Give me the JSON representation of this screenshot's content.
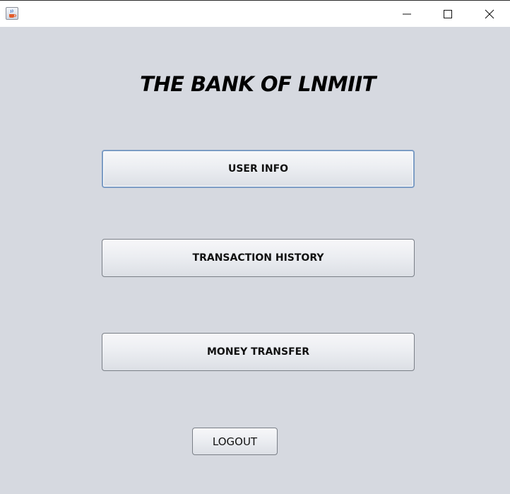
{
  "window": {
    "icon": "java-cup-icon",
    "controls": {
      "minimize": "minimize-icon",
      "maximize": "maximize-icon",
      "close": "close-icon"
    }
  },
  "main": {
    "title": "THE BANK OF LNMIIT",
    "buttons": {
      "user_info": "USER INFO",
      "transaction_history": "TRANSACTION HISTORY",
      "money_transfer": "MONEY TRANSFER",
      "logout": "LOGOUT"
    }
  },
  "colors": {
    "background": "#d6d9e0",
    "focus_border": "#7c9cc4"
  }
}
